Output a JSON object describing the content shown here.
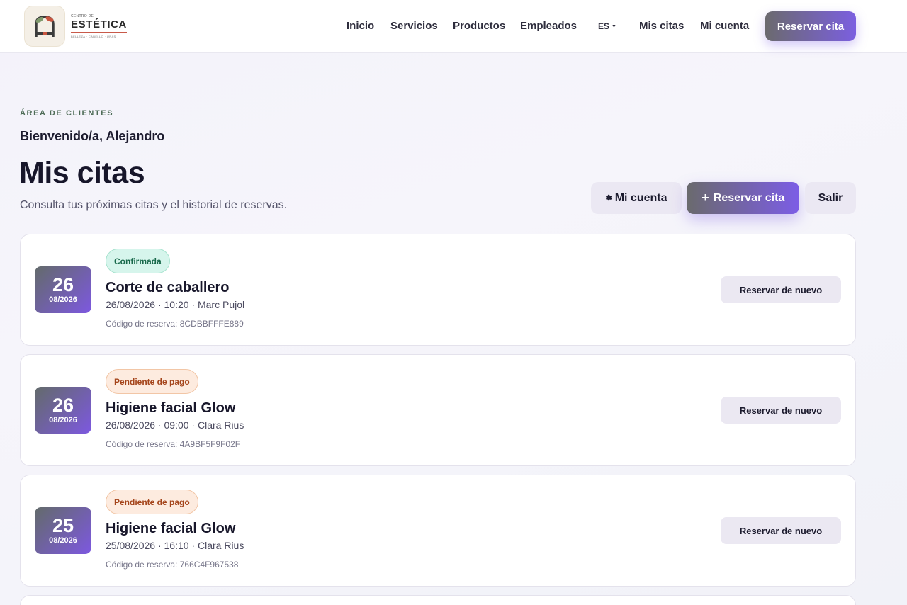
{
  "brand": {
    "line1": "CENTRO DE",
    "name": "ESTÉTICA",
    "tagline": "BELLEZA · CABELLO · UÑAS"
  },
  "nav": {
    "items": [
      "Inicio",
      "Servicios",
      "Productos",
      "Empleados"
    ],
    "language": "ES",
    "my_appointments": "Mis citas",
    "my_account": "Mi cuenta",
    "book_button": "Reservar cita"
  },
  "hero": {
    "eyebrow": "ÁREA DE CLIENTES",
    "welcome": "Bienvenido/a, Alejandro",
    "title": "Mis citas",
    "subtitle": "Consulta tus próximas citas y el historial de reservas."
  },
  "actions": {
    "account": "Mi cuenta",
    "book": "Reservar cita",
    "exit": "Salir"
  },
  "appointments": [
    {
      "day": "26",
      "month_year": "08/2026",
      "status": "Confirmada",
      "status_type": "ok",
      "service": "Corte de caballero",
      "meta": "26/08/2026 · 10:20 · Marc Pujol",
      "code": "Código de reserva: 8CDBBFFFE889",
      "rebook": "Reservar de nuevo"
    },
    {
      "day": "26",
      "month_year": "08/2026",
      "status": "Pendiente de pago",
      "status_type": "pending",
      "service": "Higiene facial Glow",
      "meta": "26/08/2026 · 09:00 · Clara Rius",
      "code": "Código de reserva: 4A9BF5F9F02F",
      "rebook": "Reservar de nuevo"
    },
    {
      "day": "25",
      "month_year": "08/2026",
      "status": "Pendiente de pago",
      "status_type": "pending",
      "service": "Higiene facial Glow",
      "meta": "25/08/2026 · 16:10 · Clara Rius",
      "code": "Código de reserva: 766C4F967538",
      "rebook": "Reservar de nuevo"
    }
  ],
  "colors": {
    "accent_start": "#6b6a6e",
    "accent_end": "#7b5fe0",
    "confirmed_bg": "#d6f5ec",
    "confirmed_text": "#17684a",
    "pending_bg": "#fdebdf",
    "pending_text": "#a4441a"
  }
}
